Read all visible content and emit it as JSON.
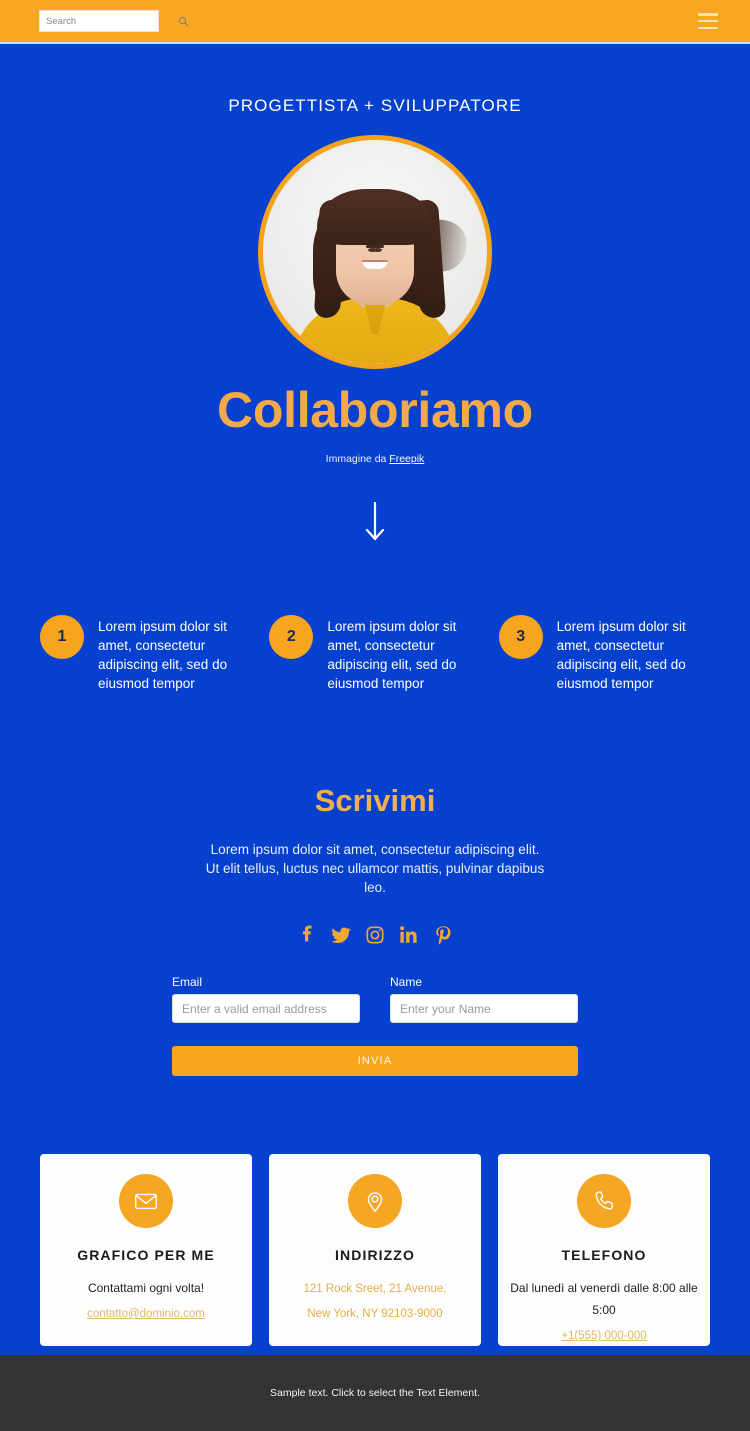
{
  "header": {
    "search": {
      "placeholder": "Search",
      "value": "",
      "icon": "search-icon"
    },
    "menu_icon": "hamburger-menu-icon",
    "bg_color": "#f9a623"
  },
  "hero": {
    "kicker": "PROGETTISTA + SVILUPPATORE",
    "title": "Collaboriamo",
    "credit_prefix": "Immagine da ",
    "credit_link": "Freepik",
    "avatar_alt": "portrait-photo",
    "scroll_icon": "down-arrow-icon",
    "bg_color": "#0540cf",
    "accent_color": "#f2a21d"
  },
  "steps": [
    {
      "number": "1",
      "text": "Lorem ipsum dolor sit amet, consectetur adipiscing elit, sed do eiusmod tempor"
    },
    {
      "number": "2",
      "text": "Lorem ipsum dolor sit amet, consectetur adipiscing elit, sed do eiusmod tempor"
    },
    {
      "number": "3",
      "text": "Lorem ipsum dolor sit amet, consectetur adipiscing elit, sed do eiusmod tempor"
    }
  ],
  "write": {
    "heading": "Scrivimi",
    "paragraph": "Lorem ipsum dolor sit amet, consectetur adipiscing elit. Ut elit tellus, luctus nec ullamcor mattis, pulvinar dapibus leo.",
    "socials": [
      {
        "name": "facebook-icon",
        "label": "Facebook"
      },
      {
        "name": "twitter-icon",
        "label": "Twitter"
      },
      {
        "name": "instagram-icon",
        "label": "Instagram"
      },
      {
        "name": "linkedin-icon",
        "label": "LinkedIn"
      },
      {
        "name": "pinterest-icon",
        "label": "Pinterest"
      }
    ],
    "social_color": "#f0a832"
  },
  "form": {
    "email_label": "Email",
    "email_placeholder": "Enter a valid email address",
    "email_value": "",
    "name_label": "Name",
    "name_placeholder": "Enter your Name",
    "name_value": "",
    "submit_label": "INVIA",
    "submit_color": "#f9a61f"
  },
  "cards": [
    {
      "icon": "envelope-icon",
      "title": "GRAFICO PER ME",
      "line": "Contattami ogni volta!",
      "link": "contatto@dominio.com"
    },
    {
      "icon": "location-pin-icon",
      "title": "INDIRIZZO",
      "address_line1": "121 Rock Sreet, 21 Avenue,",
      "address_line2": "New York, NY 92103-9000"
    },
    {
      "icon": "phone-icon",
      "title": "TELEFONO",
      "line": "Dal lunedì al venerdì dalle 8:00 alle 5:00",
      "link": "+1(555) 000-000"
    }
  ],
  "footer": {
    "text": "Sample text. Click to select the Text Element.",
    "bg_color": "#333333"
  }
}
